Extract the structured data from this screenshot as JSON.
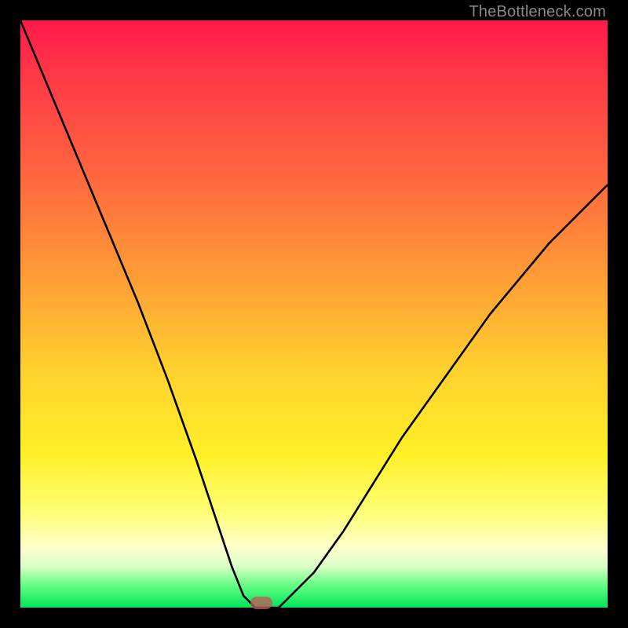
{
  "watermark": "TheBottleneck.com",
  "chart_data": {
    "type": "line",
    "title": "",
    "xlabel": "",
    "ylabel": "",
    "xlim": [
      0,
      100
    ],
    "ylim": [
      0,
      100
    ],
    "grid": false,
    "legend": false,
    "series": [
      {
        "name": "bottleneck-curve",
        "x": [
          0,
          5,
          10,
          15,
          20,
          25,
          30,
          33,
          36,
          38,
          40,
          42,
          44,
          50,
          55,
          60,
          65,
          70,
          75,
          80,
          85,
          90,
          95,
          100
        ],
        "y": [
          100,
          88,
          76,
          64,
          52,
          39,
          25,
          16,
          7,
          2,
          0,
          0,
          0,
          6,
          13,
          21,
          29,
          36,
          43,
          50,
          56,
          62,
          67,
          72
        ]
      }
    ],
    "marker": {
      "x": 41,
      "y": 0,
      "color": "#c05a57"
    }
  }
}
